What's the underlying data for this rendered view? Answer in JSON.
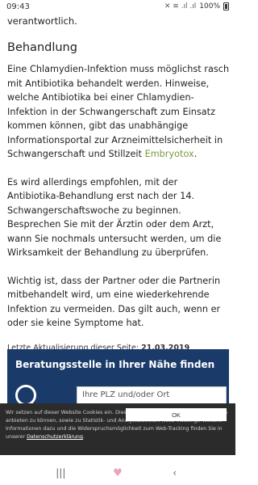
{
  "status_bar": {
    "time": "09:43",
    "icons": "✕ ≋ .ıl .ıl",
    "battery": "100%"
  },
  "article": {
    "fragment": "verantwortlich.",
    "heading": "Behandlung",
    "para1_text": "Eine Chlamydien-Infektion muss möglichst rasch mit Antibiotika behandelt werden. Hinweise, welche Antibiotika bei einer Chlamydien-Infektion in der Schwangerschaft zum Einsatz kommen können, gibt das unabhängige Informationsportal zur Arzneimittelsicherheit in Schwangerschaft und Stillzeit ",
    "para1_link": "Embryotox",
    "para1_end": ".",
    "para2": "Es wird allerdings empfohlen, mit der Antibiotika-Behandlung erst nach der 14. Schwangerschaftswoche zu beginnen. Besprechen Sie mit der Ärztin oder dem Arzt, wann Sie nochmals untersucht werden, um die Wirksamkeit der Behandlung zu überprüfen.",
    "para3": "Wichtig ist, dass der Partner oder die Partnerin mitbehandelt wird, um eine wiederkehrende Infektion zu vermeiden. Das gilt auch, wenn er oder sie keine Symptome hat.",
    "updated_label": "Letzte Aktualisierung dieser Seite: ",
    "updated_date": "21.03.2019"
  },
  "advice_box": {
    "title": "Beratungsstelle in Ihrer Nähe finden",
    "placeholder": "Ihre PLZ und/oder Ort"
  },
  "cookie_banner": {
    "text": "Wir setzen auf dieser Website Cookies ein. Diese dienen dazu, Ihnen Servicefunktionen anbieten zu können, sowie zu Statistik- und Analysezwecken (Web-Tracking). Weitere Informationen dazu und die Widerspruchsmöglichkeit zum Web-Tracking finden Sie in unserer ",
    "privacy_link": "Datenschutzerklärung",
    "text_end": ".",
    "ok_label": "OK"
  },
  "nav_bar": {
    "recents_icon": "|||",
    "home_icon": "♥",
    "back_icon": "‹"
  }
}
